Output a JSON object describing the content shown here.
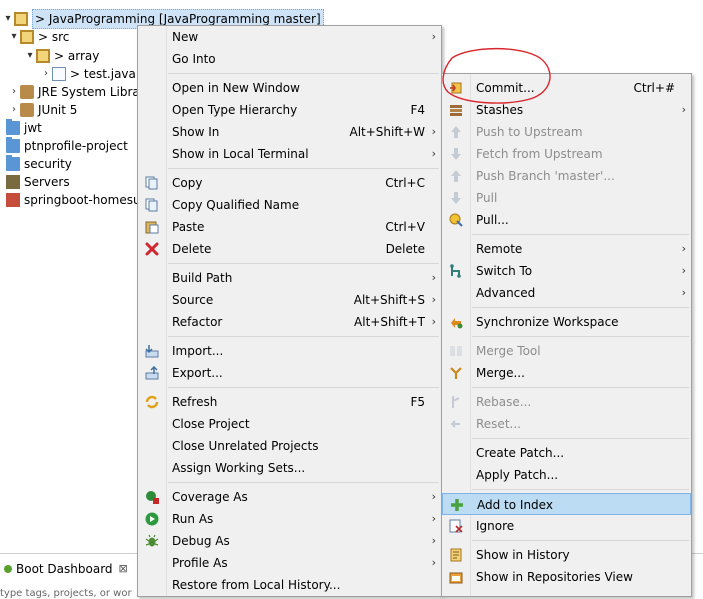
{
  "explorer": {
    "items": [
      {
        "label": "> JavaProgramming [JavaProgramming master]",
        "twisty": "▾",
        "icon": "project-icon"
      },
      {
        "label": "> src",
        "twisty": "▾",
        "icon": "source-folder-icon"
      },
      {
        "label": "> array",
        "twisty": "▾",
        "icon": "package-icon"
      },
      {
        "label": "> test.java",
        "twisty": "›",
        "icon": "java-file-icon"
      },
      {
        "label": "JRE System Librar",
        "twisty": "›",
        "icon": "library-icon"
      },
      {
        "label": "JUnit 5",
        "twisty": "›",
        "icon": "library-icon"
      },
      {
        "label": "jwt",
        "twisty": "",
        "icon": "folder-icon"
      },
      {
        "label": "ptnprofile-project",
        "twisty": "",
        "icon": "folder-icon"
      },
      {
        "label": "security",
        "twisty": "",
        "icon": "folder-icon"
      },
      {
        "label": "Servers",
        "twisty": "",
        "icon": "servers-icon"
      },
      {
        "label": "springboot-homesu",
        "twisty": "",
        "icon": "maven-project-icon"
      }
    ]
  },
  "bottom": {
    "tab_label": "Boot Dashboard",
    "close_glyph": "⊠",
    "hint": "type tags, projects, or wor"
  },
  "main_menu": {
    "items": [
      {
        "label": "New",
        "shortcut": "",
        "arrow": "›",
        "icon": ""
      },
      {
        "label": "Go Into",
        "shortcut": "",
        "arrow": "",
        "icon": ""
      },
      {
        "label": "Open in New Window",
        "shortcut": "",
        "arrow": "",
        "icon": ""
      },
      {
        "label": "Open Type Hierarchy",
        "shortcut": "F4",
        "arrow": "",
        "icon": ""
      },
      {
        "label": "Show In",
        "shortcut": "Alt+Shift+W",
        "arrow": "›",
        "icon": ""
      },
      {
        "label": "Show in Local Terminal",
        "shortcut": "",
        "arrow": "›",
        "icon": ""
      },
      {
        "label": "Copy",
        "shortcut": "Ctrl+C",
        "arrow": "",
        "icon": "copy-icon"
      },
      {
        "label": "Copy Qualified Name",
        "shortcut": "",
        "arrow": "",
        "icon": "copy-qualified-icon"
      },
      {
        "label": "Paste",
        "shortcut": "Ctrl+V",
        "arrow": "",
        "icon": "paste-icon"
      },
      {
        "label": "Delete",
        "shortcut": "Delete",
        "arrow": "",
        "icon": "delete-icon"
      },
      {
        "label": "Build Path",
        "shortcut": "",
        "arrow": "›",
        "icon": ""
      },
      {
        "label": "Source",
        "shortcut": "Alt+Shift+S",
        "arrow": "›",
        "icon": ""
      },
      {
        "label": "Refactor",
        "shortcut": "Alt+Shift+T",
        "arrow": "›",
        "icon": ""
      },
      {
        "label": "Import...",
        "shortcut": "",
        "arrow": "",
        "icon": "import-icon"
      },
      {
        "label": "Export...",
        "shortcut": "",
        "arrow": "",
        "icon": "export-icon"
      },
      {
        "label": "Refresh",
        "shortcut": "F5",
        "arrow": "",
        "icon": "refresh-icon"
      },
      {
        "label": "Close Project",
        "shortcut": "",
        "arrow": "",
        "icon": ""
      },
      {
        "label": "Close Unrelated Projects",
        "shortcut": "",
        "arrow": "",
        "icon": ""
      },
      {
        "label": "Assign Working Sets...",
        "shortcut": "",
        "arrow": "",
        "icon": ""
      },
      {
        "label": "Coverage As",
        "shortcut": "",
        "arrow": "›",
        "icon": "coverage-icon"
      },
      {
        "label": "Run As",
        "shortcut": "",
        "arrow": "›",
        "icon": "run-icon"
      },
      {
        "label": "Debug As",
        "shortcut": "",
        "arrow": "›",
        "icon": "debug-icon"
      },
      {
        "label": "Profile As",
        "shortcut": "",
        "arrow": "›",
        "icon": ""
      },
      {
        "label": "Restore from Local History...",
        "shortcut": "",
        "arrow": "",
        "icon": ""
      }
    ]
  },
  "team_menu": {
    "items": [
      {
        "label": "Commit...",
        "shortcut": "Ctrl+#",
        "arrow": "",
        "icon": "commit-icon",
        "disabled": false
      },
      {
        "label": "Stashes",
        "shortcut": "",
        "arrow": "›",
        "icon": "stash-icon",
        "disabled": false
      },
      {
        "label": "Push to Upstream",
        "shortcut": "",
        "arrow": "",
        "icon": "push-icon",
        "disabled": true
      },
      {
        "label": "Fetch from Upstream",
        "shortcut": "",
        "arrow": "",
        "icon": "fetch-icon",
        "disabled": true
      },
      {
        "label": "Push Branch 'master'...",
        "shortcut": "",
        "arrow": "",
        "icon": "push-branch-icon",
        "disabled": true
      },
      {
        "label": "Pull",
        "shortcut": "",
        "arrow": "",
        "icon": "pull-icon",
        "disabled": true
      },
      {
        "label": "Pull...",
        "shortcut": "",
        "arrow": "",
        "icon": "pull-dialog-icon",
        "disabled": false
      },
      {
        "label": "Remote",
        "shortcut": "",
        "arrow": "›",
        "icon": "",
        "disabled": false
      },
      {
        "label": "Switch To",
        "shortcut": "",
        "arrow": "›",
        "icon": "switch-branch-icon",
        "disabled": false
      },
      {
        "label": "Advanced",
        "shortcut": "",
        "arrow": "›",
        "icon": "",
        "disabled": false
      },
      {
        "label": "Synchronize Workspace",
        "shortcut": "",
        "arrow": "",
        "icon": "synchronize-icon",
        "disabled": false
      },
      {
        "label": "Merge Tool",
        "shortcut": "",
        "arrow": "",
        "icon": "merge-tool-icon",
        "disabled": true
      },
      {
        "label": "Merge...",
        "shortcut": "",
        "arrow": "",
        "icon": "merge-icon",
        "disabled": false
      },
      {
        "label": "Rebase...",
        "shortcut": "",
        "arrow": "",
        "icon": "rebase-icon",
        "disabled": true
      },
      {
        "label": "Reset...",
        "shortcut": "",
        "arrow": "",
        "icon": "reset-icon",
        "disabled": true
      },
      {
        "label": "Create Patch...",
        "shortcut": "",
        "arrow": "",
        "icon": "",
        "disabled": false
      },
      {
        "label": "Apply Patch...",
        "shortcut": "",
        "arrow": "",
        "icon": "",
        "disabled": false
      },
      {
        "label": "Add to Index",
        "shortcut": "",
        "arrow": "",
        "icon": "add-icon",
        "disabled": false,
        "highlighted": true
      },
      {
        "label": "Ignore",
        "shortcut": "",
        "arrow": "",
        "icon": "ignore-icon",
        "disabled": false
      },
      {
        "label": "Show in History",
        "shortcut": "",
        "arrow": "",
        "icon": "history-icon",
        "disabled": false
      },
      {
        "label": "Show in Repositories View",
        "shortcut": "",
        "arrow": "",
        "icon": "repositories-icon",
        "disabled": false
      }
    ]
  },
  "colors": {
    "menu_bg": "#f0f0f0",
    "highlight": "#bcdcf4",
    "annotation": "#d9262c",
    "disabled_text": "#8d8d8d"
  }
}
